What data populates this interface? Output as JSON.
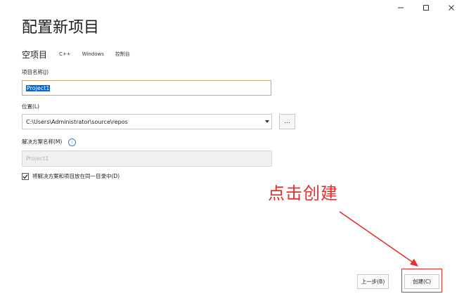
{
  "title": "配置新项目",
  "project_type": {
    "name": "空项目",
    "tags": [
      "C++",
      "Windows",
      "控制台"
    ]
  },
  "fields": {
    "project_name": {
      "label": "项目名称(J)",
      "value": "Project1"
    },
    "location": {
      "label": "位置(L)",
      "value": "C:\\Users\\Administrator\\source\\repos",
      "browse_label": "..."
    },
    "solution_name": {
      "label": "解决方案名称(M)",
      "placeholder": "Project1",
      "info_symbol": "i"
    }
  },
  "checkbox": {
    "label": "将解决方案和项目放在同一目录中(D)",
    "checked": true
  },
  "annotation": {
    "text": "点击创建",
    "color": "#e52f2f"
  },
  "buttons": {
    "back": "上一步(B)",
    "create": "创建(C)"
  },
  "colors": {
    "selection": "#0a67d0",
    "focus_border": "#d3a878",
    "annotation": "#e52f2f"
  }
}
